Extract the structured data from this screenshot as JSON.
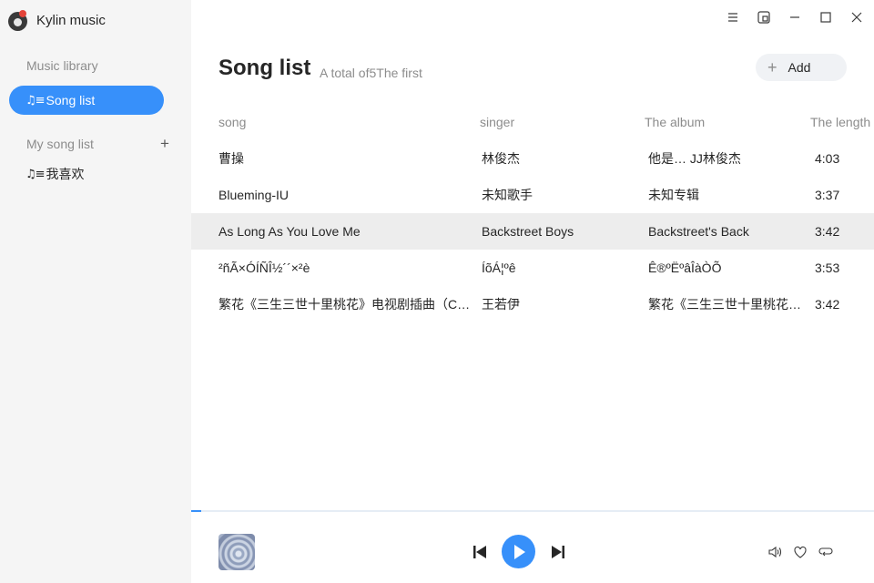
{
  "app": {
    "title": "Kylin music"
  },
  "sidebar": {
    "library_label": "Music library",
    "song_list_label": "Song list",
    "my_song_list_label": "My song list",
    "playlists": [
      {
        "label": "我喜欢"
      }
    ]
  },
  "header": {
    "title": "Song list",
    "subtitle": "A total of5The first",
    "add_label": "Add"
  },
  "table": {
    "columns": [
      "song",
      "singer",
      "The album",
      "The length"
    ],
    "rows": [
      {
        "song": "曹操",
        "singer": "林俊杰",
        "album": "他是… JJ林俊杰",
        "length": "4:03"
      },
      {
        "song": "Blueming-IU",
        "singer": "未知歌手",
        "album": "未知专辑",
        "length": "3:37"
      },
      {
        "song": "As Long As You Love Me",
        "singer": "Backstreet Boys",
        "album": "Backstreet's Back",
        "length": "3:42",
        "selected": true
      },
      {
        "song": "²ñÃ×ÓÍÑÎ½´´×²è",
        "singer": "ÍõÁ¦ºê",
        "album": "Ê®ºËºâÎàÒÕ",
        "length": "3:53"
      },
      {
        "song": "繁花《三生三世十里桃花》电视剧插曲（C…",
        "singer": "王若伊",
        "album": "繁花《三生三世十里桃花…",
        "length": "3:42"
      }
    ]
  },
  "player": {
    "progress_fraction": 0.015
  },
  "icons": {
    "menu": "menu-icon",
    "mini": "mini-mode-icon",
    "minimize": "minimize-icon",
    "maximize": "maximize-icon",
    "close": "close-icon",
    "prev": "previous-icon",
    "play": "play-icon",
    "next": "next-icon",
    "volume": "volume-icon",
    "favorite": "heart-icon",
    "loop": "loop-icon"
  },
  "colors": {
    "accent": "#3790fa",
    "sidebar_bg": "#f5f5f5",
    "selected_row": "#ededed"
  }
}
